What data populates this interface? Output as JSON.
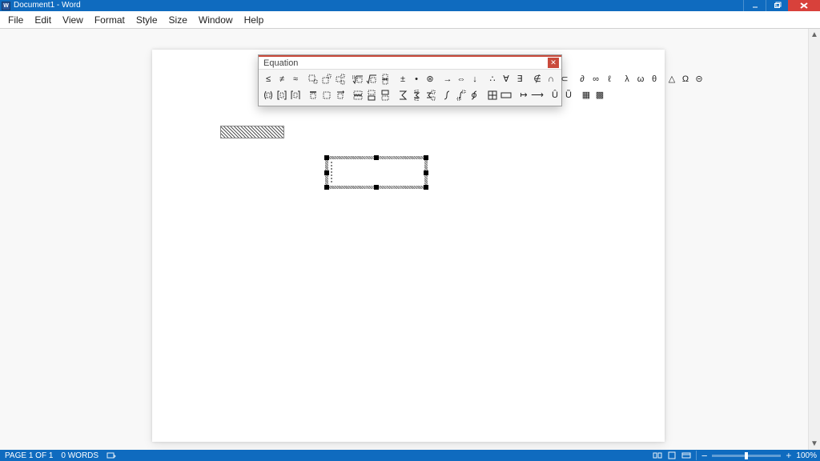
{
  "app": {
    "title": "Document1 - Word"
  },
  "menu": {
    "items": [
      "File",
      "Edit",
      "View",
      "Format",
      "Style",
      "Size",
      "Window",
      "Help"
    ]
  },
  "equation_toolbar": {
    "title": "Equation",
    "rows": [
      [
        [
          "leq",
          "neq",
          "approx"
        ],
        [
          "sub",
          "sup",
          "subsup"
        ],
        [
          "nthroot",
          "sqrt",
          "frac"
        ],
        [
          "plusminus",
          "cdot",
          "circledtimes"
        ],
        [
          "rightarrow",
          "dblarrow",
          "downarrow"
        ],
        [
          "therefore",
          "forall",
          "exists"
        ],
        [
          "notin",
          "cap",
          "subset"
        ],
        [
          "partial",
          "infty",
          "ell"
        ],
        [
          "lambda",
          "omega",
          "theta"
        ],
        [
          "triangle",
          "Omega",
          "circledminus"
        ]
      ],
      [
        [
          "paren",
          "bracket",
          "ceil"
        ],
        [
          "bar",
          "box",
          "vec"
        ],
        [
          "fracbox",
          "boxover",
          "boxunder"
        ],
        [
          "sum",
          "sumlimits",
          "sumsubsup"
        ],
        [
          "int",
          "intlimits",
          "oint"
        ],
        [
          "matrix1",
          "wideframe"
        ],
        [
          "mapsto",
          "longright"
        ],
        [
          "upcirc",
          "downcirc"
        ],
        [
          "hash",
          "grid"
        ]
      ]
    ]
  },
  "status": {
    "page": "PAGE 1 OF 1",
    "words": "0 WORDS",
    "zoom": "100%"
  }
}
